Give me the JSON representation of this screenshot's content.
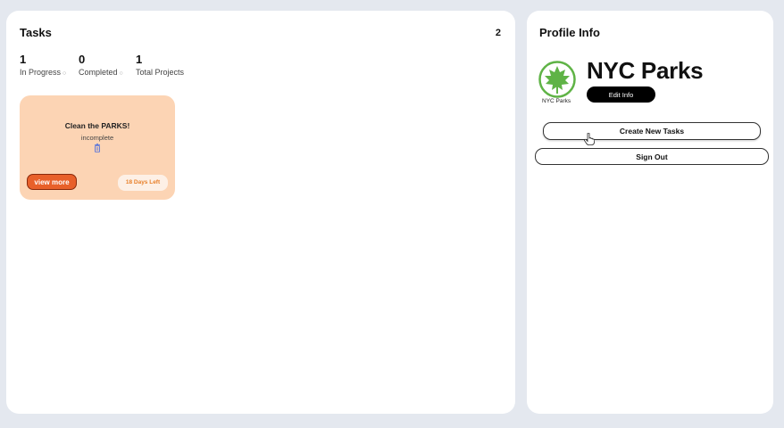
{
  "tasks": {
    "title": "Tasks",
    "count": "2",
    "stats": [
      {
        "value": "1",
        "label": "In Progress"
      },
      {
        "value": "0",
        "label": "Completed"
      },
      {
        "value": "1",
        "label": "Total Projects"
      }
    ],
    "card": {
      "title": "Clean the PARKS!",
      "status": "incomplete",
      "view_label": "view more",
      "days_left": "18 Days Left"
    }
  },
  "profile": {
    "title": "Profile Info",
    "name": "NYC Parks",
    "logo_caption": "NYC Parks",
    "edit_label": "Edit Info",
    "create_label": "Create New Tasks",
    "signout_label": "Sign Out"
  },
  "icons": {
    "logo": "nyc-parks-leaf-logo",
    "trash": "trash-icon",
    "cursor": "hand-pointer-icon"
  },
  "colors": {
    "card_bg": "#fcd4b4",
    "view_button": "#e8602a",
    "days_text": "#e8802a",
    "logo_green": "#5fb346"
  }
}
